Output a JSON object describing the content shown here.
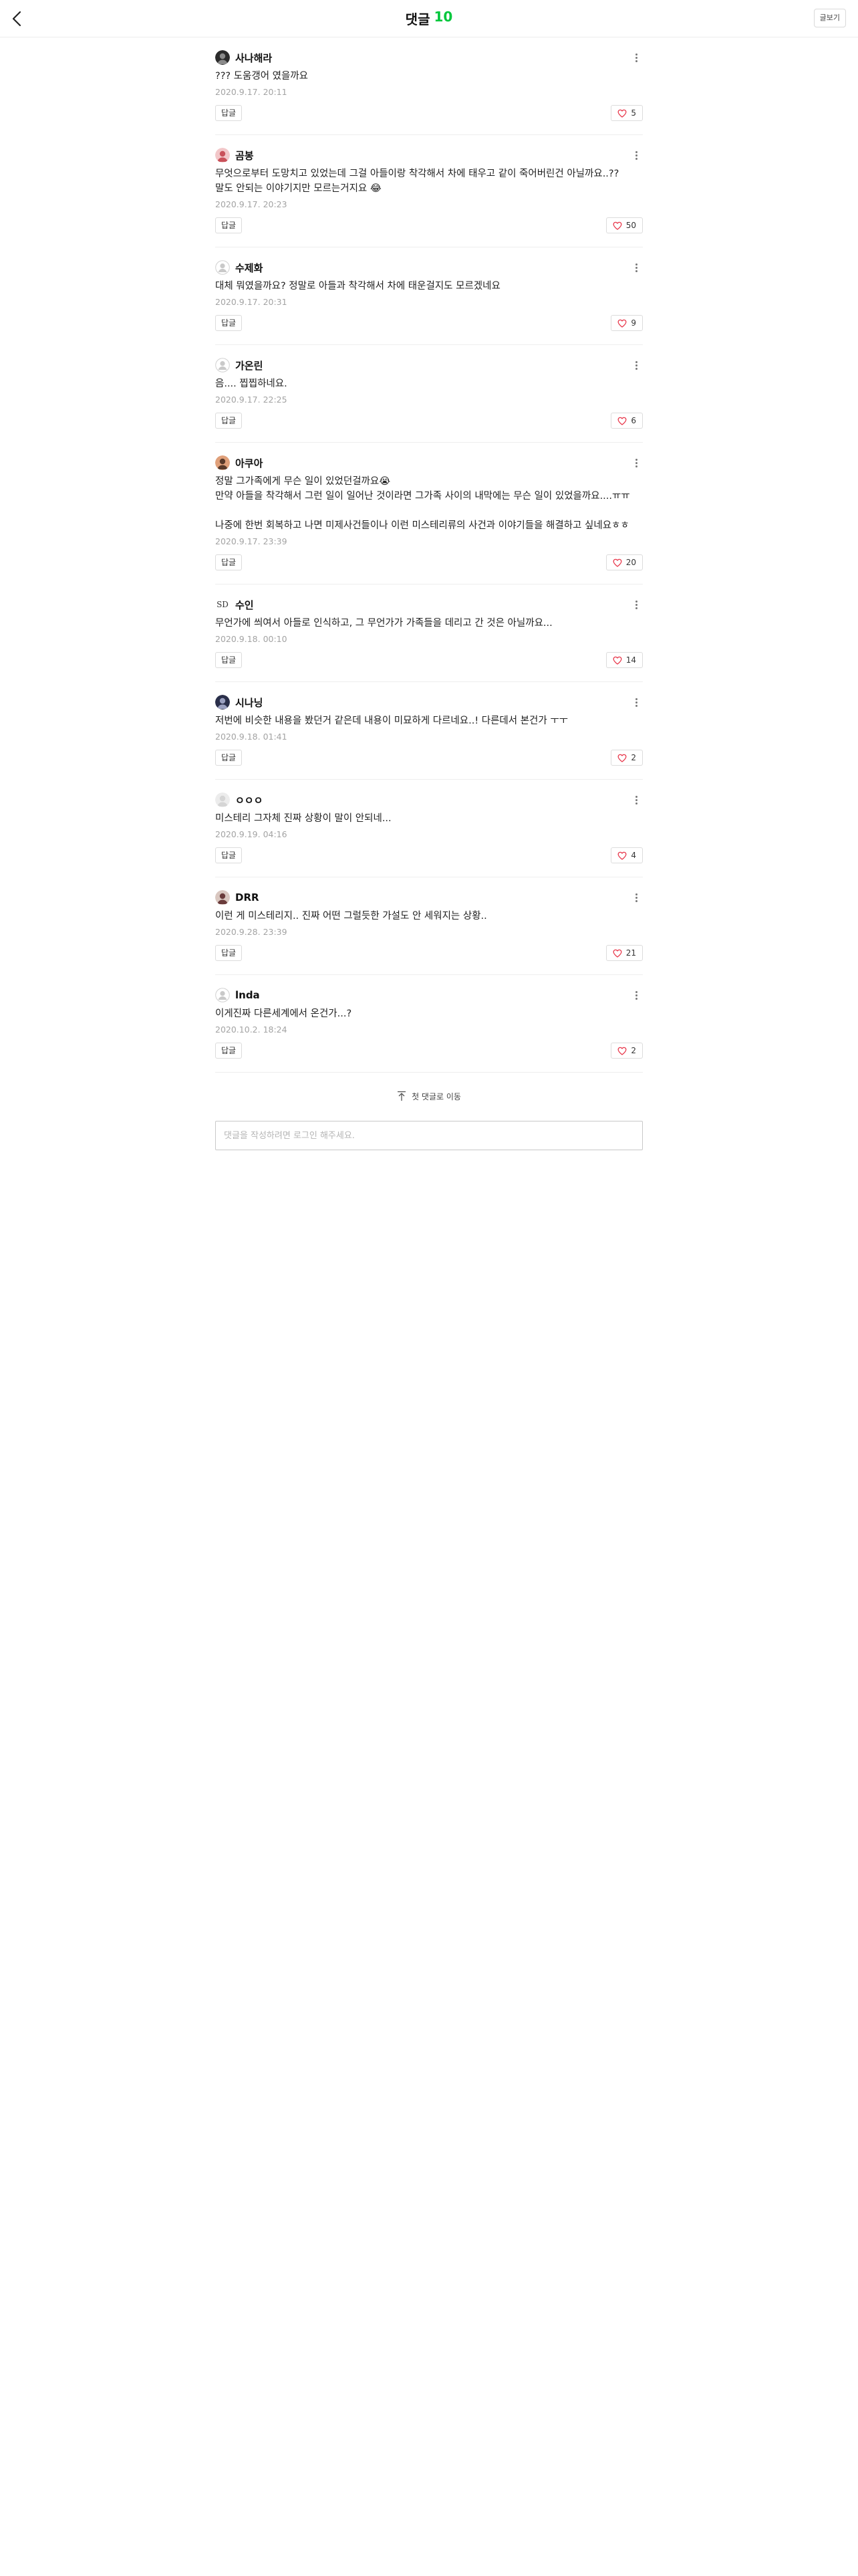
{
  "header": {
    "title": "댓글",
    "count": "10",
    "write_label": "글보기"
  },
  "comments": [
    {
      "nick": "사나해라",
      "avatar": "photo-avatar-dark",
      "text": "??? 도움갱어 였을까요",
      "date": "2020.9.17. 20:11",
      "reply": "답글",
      "likes": "5"
    },
    {
      "nick": "곰봉",
      "avatar": "photo-avatar-pink",
      "text": "무엇으로부터 도망치고 있었는데 그걸 아들이랑 착각해서 차에 태우고 같이 죽어버린건 아닐까요..??\n말도 안되는 이야기지만 모르는거지요 😂",
      "date": "2020.9.17. 20:23",
      "reply": "답글",
      "likes": "50"
    },
    {
      "nick": "수제화",
      "avatar": "default-avatar",
      "text": "대체 뭐였을까요? 정말로 아들과 착각해서 차에 태운걸지도 모르겠네요",
      "date": "2020.9.17. 20:31",
      "reply": "답글",
      "likes": "9"
    },
    {
      "nick": "가온린",
      "avatar": "default-avatar",
      "text": "음.... 찝찝하네요.",
      "date": "2020.9.17. 22:25",
      "reply": "답글",
      "likes": "6"
    },
    {
      "nick": "아쿠아",
      "avatar": "photo-avatar-orange",
      "text": "정말 그가족에게 무슨 일이 있었던걸까요😭\n만약 아들을 착각해서 그런 일이 일어난 것이라면 그가족 사이의 내막에는 무슨 일이 있었을까요....ㅠㅠ\n\n나중에 한번 회복하고 나면 미제사건들이나 이런 미스테리류의 사건과 이야기들을 해결하고 싶네요ㅎㅎ",
      "date": "2020.9.17. 23:39",
      "reply": "답글",
      "likes": "20"
    },
    {
      "nick": "수인",
      "avatar": "text-avatar-sd",
      "avatar_text": "SD",
      "text": "무언가에 씌여서 아들로 인식하고, 그 무언가가 가족들을 데리고 간 것은 아닐까요...",
      "date": "2020.9.18. 00:10",
      "reply": "답글",
      "likes": "14"
    },
    {
      "nick": "시나닝",
      "avatar": "photo-avatar-navy",
      "text": "저번에 비슷한 내용을 봤던거 같은데 내용이 미묘하게 다르네요..! 다른데서 본건가 ㅜㅜ",
      "date": "2020.9.18. 01:41",
      "reply": "답글",
      "likes": "2"
    },
    {
      "nick": "ㅇㅇㅇ",
      "avatar": "photo-avatar-light",
      "text": "미스테리 그자체 진짜 상황이 말이 안되네...",
      "date": "2020.9.19. 04:16",
      "reply": "답글",
      "likes": "4"
    },
    {
      "nick": "DRR",
      "avatar": "photo-avatar-brown",
      "text": "이런 게 미스테리지.. 진짜 어떤 그럴듯한 가설도 안 세워지는 상황..",
      "date": "2020.9.28. 23:39",
      "reply": "답글",
      "likes": "21"
    },
    {
      "nick": "lnda",
      "avatar": "default-avatar",
      "text": "이게진짜 다른세계에서 온건가...?",
      "date": "2020.10.2. 18:24",
      "reply": "답글",
      "likes": "2"
    }
  ],
  "goto_first_label": "첫 댓글로 이동",
  "comment_input": {
    "placeholder": "댓글을 작성하려면 로그인 해주세요."
  },
  "colors": {
    "accent": "#00c73c",
    "like_heart": "#e8374b"
  }
}
